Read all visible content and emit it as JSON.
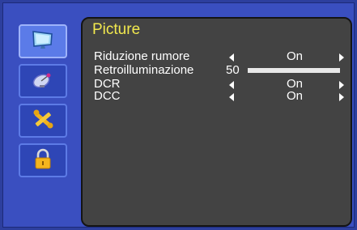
{
  "menu": {
    "title": "Picture",
    "items": [
      {
        "label": "Riduzione rumore",
        "value": "On"
      },
      {
        "label": "Retroilluminazione",
        "value": "50",
        "slider_fraction": 1.0
      },
      {
        "label": "DCR",
        "value": "On"
      },
      {
        "label": "DCC",
        "value": "On"
      }
    ]
  },
  "sidebar": {
    "icons": [
      "monitor-icon",
      "satellite-dish-icon",
      "tools-icon",
      "lock-icon"
    ],
    "active_index": 0
  }
}
